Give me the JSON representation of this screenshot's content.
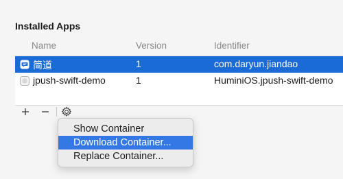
{
  "section": {
    "title": "Installed Apps"
  },
  "table": {
    "columns": {
      "name": "Name",
      "version": "Version",
      "identifier": "Identifier"
    },
    "rows": [
      {
        "name": "简道",
        "version": "1",
        "identifier": "com.daryun.jiandao",
        "selected": true,
        "icon": "app-chat-icon"
      },
      {
        "name": "jpush-swift-demo",
        "version": "1",
        "identifier": "HuminiOS.jpush-swift-demo",
        "selected": false,
        "icon": "app-placeholder-icon"
      }
    ]
  },
  "toolbar": {
    "add": "+",
    "remove": "−",
    "gear_icon": "gear-icon"
  },
  "menu": {
    "items": [
      {
        "label": "Show Container"
      },
      {
        "label": "Download Container...",
        "highlighted": true
      },
      {
        "label": "Replace Container..."
      }
    ]
  },
  "colors": {
    "selection": "#1a6bd6",
    "menu_highlight": "#3478e5"
  }
}
